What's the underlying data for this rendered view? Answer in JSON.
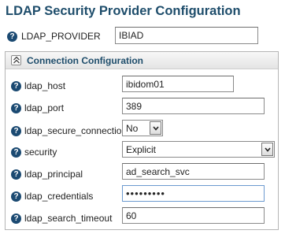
{
  "page": {
    "title": "LDAP Security Provider Configuration"
  },
  "provider": {
    "label": "LDAP_PROVIDER",
    "value": "IBIAD"
  },
  "section": {
    "title": "Connection Configuration",
    "fields": {
      "host": {
        "label": "ldap_host",
        "value": "ibidom01"
      },
      "port": {
        "label": "ldap_port",
        "value": "389"
      },
      "secure": {
        "label": "ldap_secure_connection",
        "value": "No"
      },
      "security": {
        "label": "security",
        "value": "Explicit"
      },
      "principal": {
        "label": "ldap_principal",
        "value": "ad_search_svc"
      },
      "credentials": {
        "label": "ldap_credentials",
        "value": "•••••••••"
      },
      "timeout": {
        "label": "ldap_search_timeout",
        "value": "60"
      }
    }
  },
  "icons": {
    "help": "?"
  },
  "colors": {
    "title": "#1e4d6b",
    "help_icon": "#1b4a72",
    "focus_border": "#6c9ad0"
  }
}
